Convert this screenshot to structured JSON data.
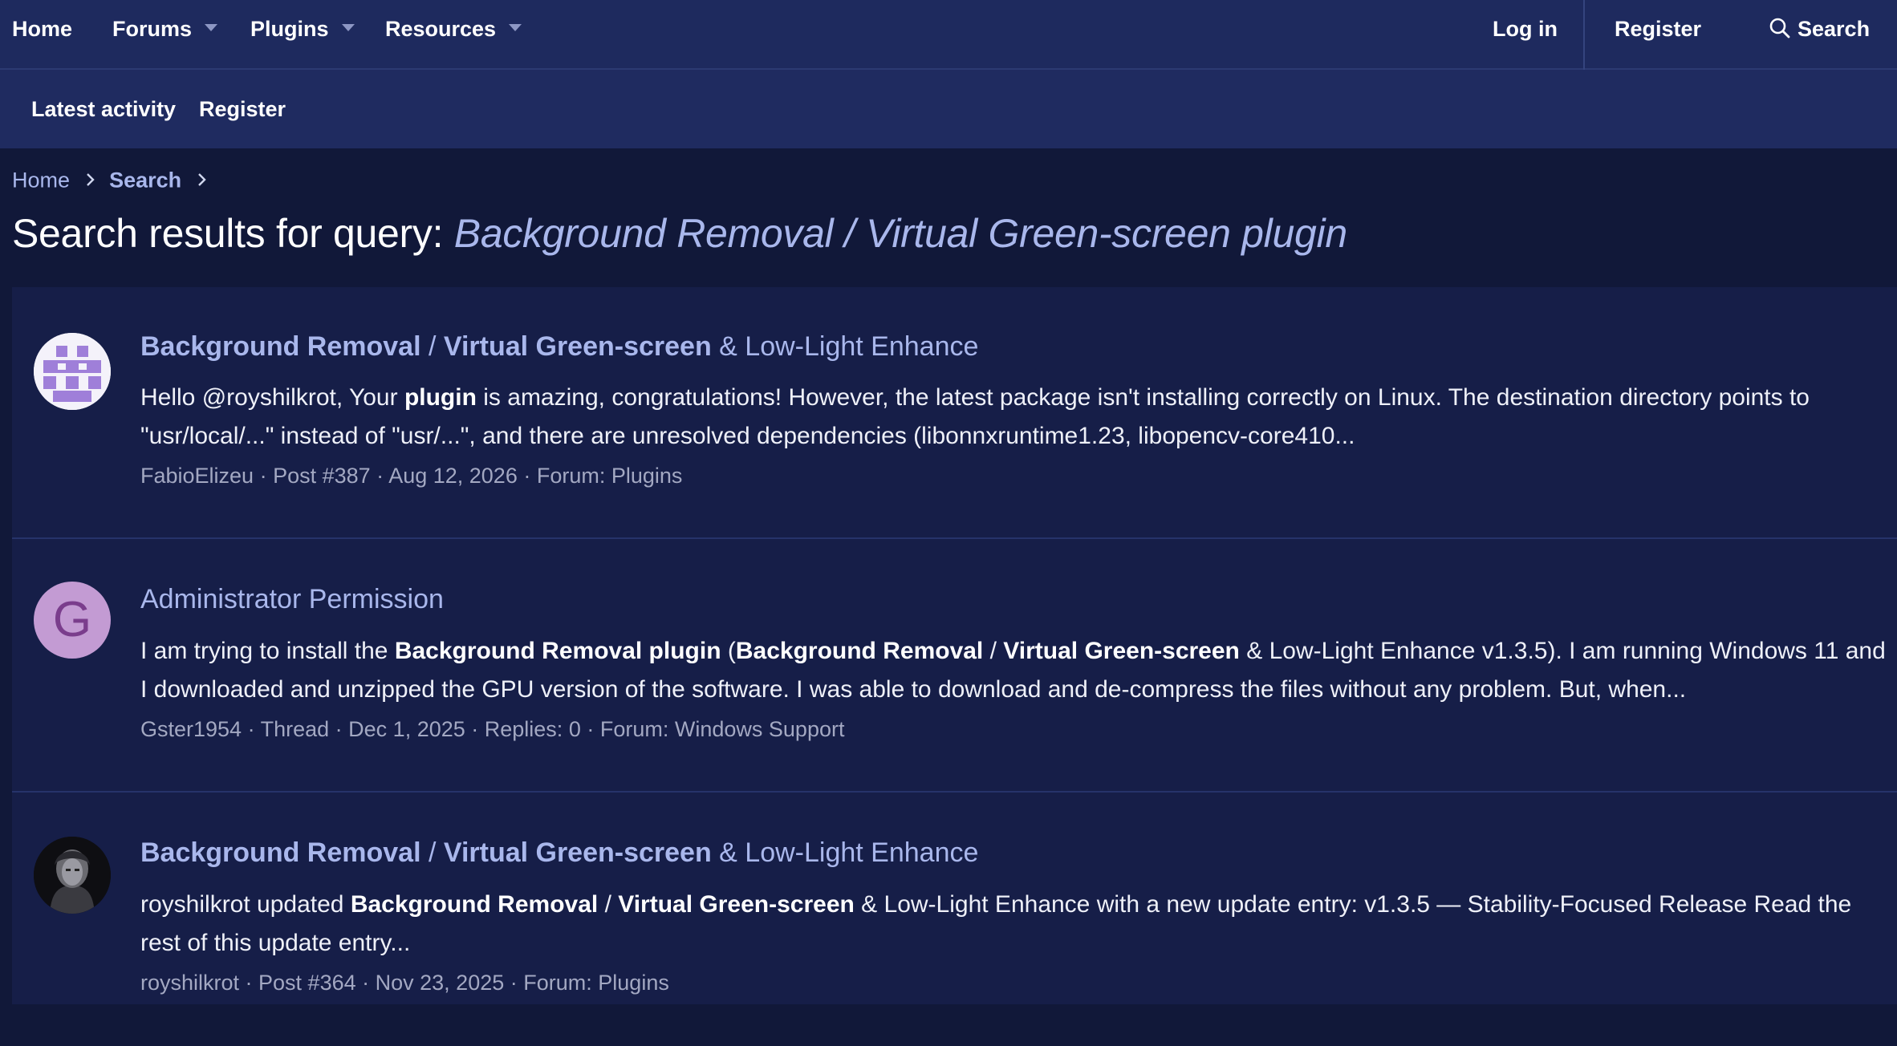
{
  "topnav": {
    "home": "Home",
    "forums": "Forums",
    "plugins": "Plugins",
    "resources": "Resources",
    "login": "Log in",
    "register": "Register",
    "search": "Search"
  },
  "subnav": {
    "latest": "Latest activity",
    "register": "Register"
  },
  "breadcrumb": {
    "home": "Home",
    "search": "Search"
  },
  "page": {
    "title_prefix": "Search results for query:",
    "query": "Background Removal / Virtual Green-screen plugin"
  },
  "results": [
    {
      "avatar": "pixel-identicon",
      "title_parts": [
        "Background Removal",
        " / ",
        "Virtual Green-screen",
        " & Low-Light Enhance"
      ],
      "snippet_parts": [
        "Hello @royshilkrot, Your ",
        "plugin",
        " is amazing, congratulations! However, the latest package isn't installing correctly on Linux. The destination directory points to \"usr/local/...\" instead of \"usr/...\", and there are unresolved dependencies (libonnxruntime1.23, libopencv-core410..."
      ],
      "meta": {
        "author": "FabioElizeu",
        "type": "Post #387",
        "date": "Aug 12, 2026",
        "forum_label": "Forum:",
        "forum": "Plugins"
      }
    },
    {
      "avatar": "G",
      "title_parts": [
        "Administrator Permission"
      ],
      "snippet_parts": [
        "I am trying to install the ",
        "Background Removal plugin",
        " (",
        "Background Removal",
        " / ",
        "Virtual Green-screen",
        " & Low-Light Enhance v1.3.5). I am running Windows 11 and I downloaded and unzipped the GPU version of the software. I was able to download and de-compress the files without any problem. But, when..."
      ],
      "meta": {
        "author": "Gster1954",
        "type": "Thread",
        "date": "Dec 1, 2025",
        "replies": "Replies: 0",
        "forum_label": "Forum:",
        "forum": "Windows Support"
      }
    },
    {
      "avatar": "photo",
      "title_parts": [
        "Background Removal",
        " / ",
        "Virtual Green-screen",
        " & Low-Light Enhance"
      ],
      "snippet_parts": [
        "royshilkrot updated ",
        "Background Removal",
        " / ",
        "Virtual Green-screen",
        " & Low-Light Enhance with a new update entry: v1.3.5 — Stability-Focused Release Read the rest of this update entry..."
      ],
      "meta": {
        "author": "royshilkrot",
        "type": "Post #364",
        "date": "Nov 23, 2025",
        "forum_label": "Forum:",
        "forum": "Plugins"
      }
    }
  ],
  "colors": {
    "nav_bg": "#1e2a5e",
    "page_bg": "#111839",
    "result_bg": "#161e48",
    "link": "#a9b7ec",
    "identicon": "#9f7fd9",
    "avatar_g": "#c39bd3"
  }
}
